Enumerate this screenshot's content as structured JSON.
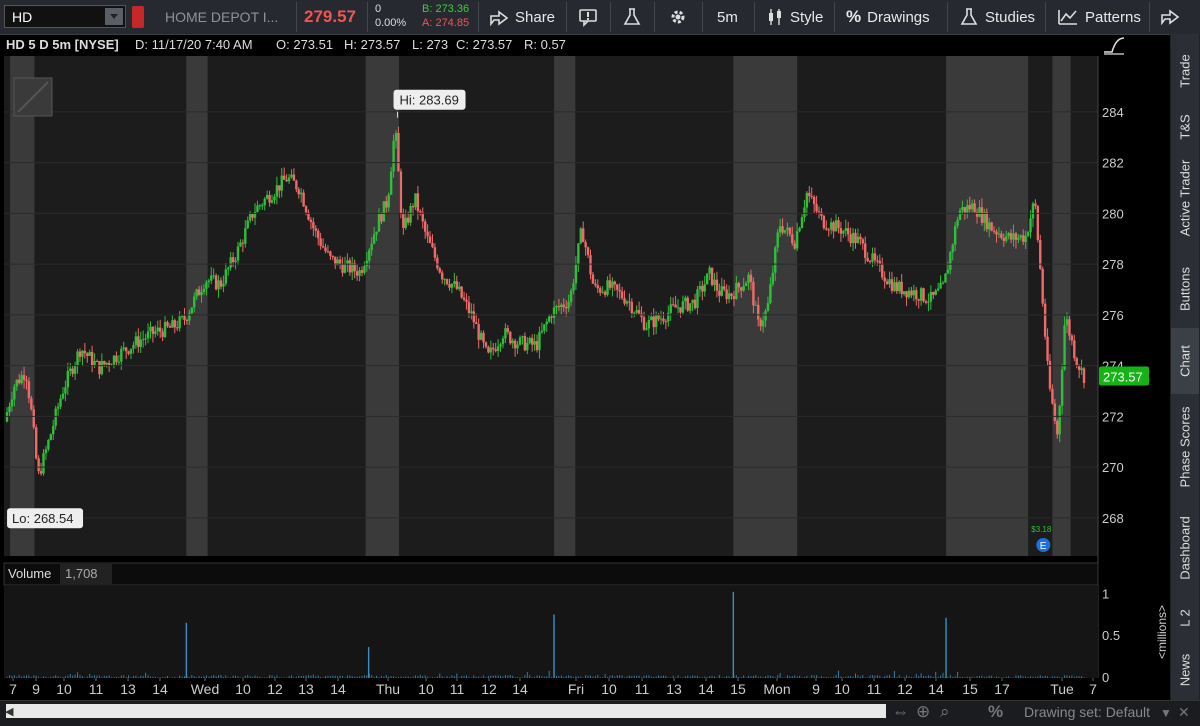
{
  "toolbar": {
    "symbol": "HD",
    "company": "HOME DEPOT I...",
    "last": "279.57",
    "change": "0",
    "change_pct": "0.00%",
    "bid": "B: 273.36",
    "ask": "A: 274.85",
    "share": "Share",
    "aggregation": "5m",
    "style": "Style",
    "drawings": "Drawings",
    "studies": "Studies",
    "patterns": "Patterns"
  },
  "header": {
    "title": "HD 5 D 5m [NYSE]",
    "d": "D: 11/17/20 7:40 AM",
    "o": "O: 273.51",
    "h": "H: 273.57",
    "l": "L: 273",
    "c": "C: 273.57",
    "r": "R: 0.57"
  },
  "chart_data": {
    "type": "candlestick",
    "ylim": [
      266.5,
      286.2
    ],
    "y_ticks": [
      "284",
      "282",
      "280",
      "278",
      "276",
      "274",
      "272",
      "270",
      "268"
    ],
    "last_price_label": "273.57",
    "hi_label": "Hi: 283.69",
    "lo_label": "Lo: 268.54",
    "earnings_marker": "E",
    "earnings_note": "$3.18",
    "x_ticks": [
      "7",
      "9",
      "10",
      "11",
      "13",
      "14",
      "Wed",
      "10",
      "12",
      "13",
      "14",
      "Thu",
      "10",
      "11",
      "12",
      "14",
      "Fri",
      "10",
      "11",
      "13",
      "14",
      "15",
      "Mon",
      "9",
      "10",
      "11",
      "12",
      "14",
      "15",
      "17",
      "Tue",
      "7"
    ],
    "path": [
      {
        "t": 0.1,
        "p": 271.8
      },
      {
        "t": 0.4,
        "p": 273.2
      },
      {
        "t": 0.8,
        "p": 273.8
      },
      {
        "t": 1.0,
        "p": 272.0
      },
      {
        "t": 1.2,
        "p": 269.6
      },
      {
        "t": 1.5,
        "p": 270.8
      },
      {
        "t": 2.0,
        "p": 273.0
      },
      {
        "t": 2.6,
        "p": 274.7
      },
      {
        "t": 3.2,
        "p": 273.9
      },
      {
        "t": 3.8,
        "p": 274.4
      },
      {
        "t": 4.4,
        "p": 274.9
      },
      {
        "t": 5.0,
        "p": 275.3
      },
      {
        "t": 5.6,
        "p": 275.5
      },
      {
        "t": 6.0,
        "p": 275.8
      },
      {
        "t": 6.7,
        "p": 277.4
      },
      {
        "t": 7.2,
        "p": 277.2
      },
      {
        "t": 7.8,
        "p": 278.6
      },
      {
        "t": 8.3,
        "p": 280.1
      },
      {
        "t": 8.8,
        "p": 280.7
      },
      {
        "t": 9.4,
        "p": 281.4
      },
      {
        "t": 9.8,
        "p": 281.0
      },
      {
        "t": 10.3,
        "p": 279.3
      },
      {
        "t": 10.8,
        "p": 278.2
      },
      {
        "t": 11.3,
        "p": 277.9
      },
      {
        "t": 11.8,
        "p": 277.7
      },
      {
        "t": 12.4,
        "p": 279.7
      },
      {
        "t": 12.7,
        "p": 280.5
      },
      {
        "t": 12.95,
        "p": 283.4
      },
      {
        "t": 13.2,
        "p": 279.2
      },
      {
        "t": 13.6,
        "p": 280.6
      },
      {
        "t": 14.0,
        "p": 279.0
      },
      {
        "t": 14.5,
        "p": 277.6
      },
      {
        "t": 15.0,
        "p": 277.0
      },
      {
        "t": 15.5,
        "p": 275.9
      },
      {
        "t": 16.0,
        "p": 274.3
      },
      {
        "t": 16.5,
        "p": 275.3
      },
      {
        "t": 17.0,
        "p": 274.9
      },
      {
        "t": 17.6,
        "p": 274.8
      },
      {
        "t": 18.1,
        "p": 276.1
      },
      {
        "t": 18.7,
        "p": 276.6
      },
      {
        "t": 19.1,
        "p": 279.4
      },
      {
        "t": 19.5,
        "p": 277.0
      },
      {
        "t": 20.0,
        "p": 277.1
      },
      {
        "t": 20.6,
        "p": 276.6
      },
      {
        "t": 21.2,
        "p": 275.6
      },
      {
        "t": 21.7,
        "p": 275.9
      },
      {
        "t": 22.2,
        "p": 276.3
      },
      {
        "t": 22.8,
        "p": 276.5
      },
      {
        "t": 23.3,
        "p": 277.6
      },
      {
        "t": 23.6,
        "p": 276.9
      },
      {
        "t": 24.0,
        "p": 276.8
      },
      {
        "t": 24.6,
        "p": 277.5
      },
      {
        "t": 24.9,
        "p": 275.6
      },
      {
        "t": 25.2,
        "p": 276.2
      },
      {
        "t": 25.6,
        "p": 279.6
      },
      {
        "t": 26.1,
        "p": 278.9
      },
      {
        "t": 26.5,
        "p": 280.8
      },
      {
        "t": 27.0,
        "p": 279.7
      },
      {
        "t": 27.6,
        "p": 279.4
      },
      {
        "t": 28.2,
        "p": 278.9
      },
      {
        "t": 28.8,
        "p": 277.9
      },
      {
        "t": 29.4,
        "p": 277.1
      },
      {
        "t": 30.0,
        "p": 276.9
      },
      {
        "t": 30.6,
        "p": 276.6
      },
      {
        "t": 31.0,
        "p": 277.1
      },
      {
        "t": 31.5,
        "p": 280.1
      },
      {
        "t": 32.0,
        "p": 280.3
      },
      {
        "t": 32.6,
        "p": 279.4
      },
      {
        "t": 33.2,
        "p": 279.0
      },
      {
        "t": 33.7,
        "p": 279.1
      },
      {
        "t": 34.0,
        "p": 280.5
      },
      {
        "t": 34.2,
        "p": 277.5
      },
      {
        "t": 34.45,
        "p": 273.4
      },
      {
        "t": 34.75,
        "p": 271.2
      },
      {
        "t": 35.0,
        "p": 276.0
      },
      {
        "t": 35.35,
        "p": 274.3
      },
      {
        "t": 35.6,
        "p": 273.6
      }
    ],
    "volume": {
      "label": "Volume",
      "value": "1,708",
      "unit": "<millions>",
      "ylim": [
        0,
        1.1
      ],
      "y_ticks": [
        "1",
        "0.5",
        "0"
      ],
      "spikes": [
        {
          "t": 6.0,
          "v": 0.66
        },
        {
          "t": 12.0,
          "v": 0.37
        },
        {
          "t": 18.1,
          "v": 0.76
        },
        {
          "t": 24.0,
          "v": 1.03
        },
        {
          "t": 31.0,
          "v": 0.72
        }
      ]
    }
  },
  "sidebar": {
    "tabs": [
      "Trade",
      "T&S",
      "Active Trader",
      "Buttons",
      "Chart",
      "Phase Scores",
      "Dashboard",
      "L 2",
      "News"
    ]
  },
  "bottom": {
    "drawing_set": "Drawing set: Default"
  },
  "colors": {
    "up": "#2fbf3a",
    "down": "#f06a6a",
    "ext_hours": "#3a3a3a",
    "last_price": "#16b316",
    "price_red": "#f25454"
  }
}
